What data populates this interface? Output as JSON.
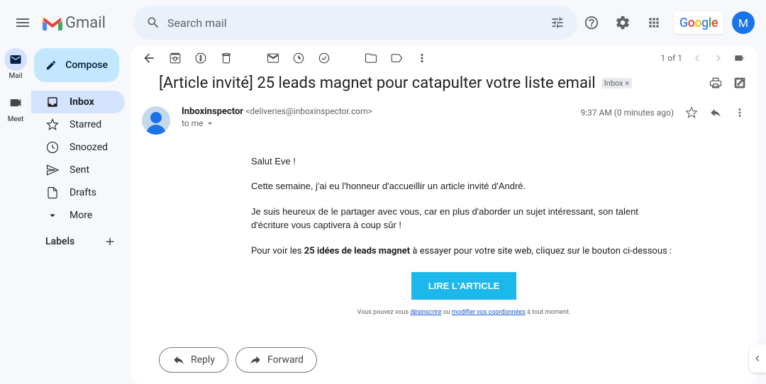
{
  "header": {
    "product": "Gmail",
    "search_placeholder": "Search mail",
    "avatar_letter": "M",
    "google": "Google"
  },
  "rail": {
    "mail": "Mail",
    "meet": "Meet"
  },
  "sidebar": {
    "compose": "Compose",
    "items": [
      {
        "label": "Inbox"
      },
      {
        "label": "Starred"
      },
      {
        "label": "Snoozed"
      },
      {
        "label": "Sent"
      },
      {
        "label": "Drafts"
      },
      {
        "label": "More"
      }
    ],
    "labels_header": "Labels"
  },
  "toolbar": {
    "counter": "1 of 1"
  },
  "email": {
    "subject": "[Article invité] 25 leads magnet pour catapulter votre liste email",
    "chip": "Inbox",
    "sender_name": "Inboxinspector",
    "sender_email": "<deliveries@inboxinspector.com>",
    "to_line": "to me",
    "time": "9:37 AM (0 minutes ago)",
    "body": {
      "p1": "Salut Eve !",
      "p2": "Cette semaine, j'ai eu l'honneur d'accueillir un article invité d'André.",
      "p3": "Je suis heureux de le partager avec vous, car en plus d'aborder un sujet intéressant, son talent d'écriture vous captivera à coup sûr !",
      "p4a": "Pour voir les ",
      "p4b": "25 idées de leads magnet",
      "p4c": " à essayer pour votre site web, cliquez sur le bouton ci-dessous :",
      "cta": "LIRE L'ARTICLE",
      "footer_a": "Vous pouvez vous ",
      "footer_link1": "désinscrire",
      "footer_b": " ou ",
      "footer_link2": "modifier vos coordonnées",
      "footer_c": " à tout moment."
    }
  },
  "actions": {
    "reply": "Reply",
    "forward": "Forward"
  }
}
